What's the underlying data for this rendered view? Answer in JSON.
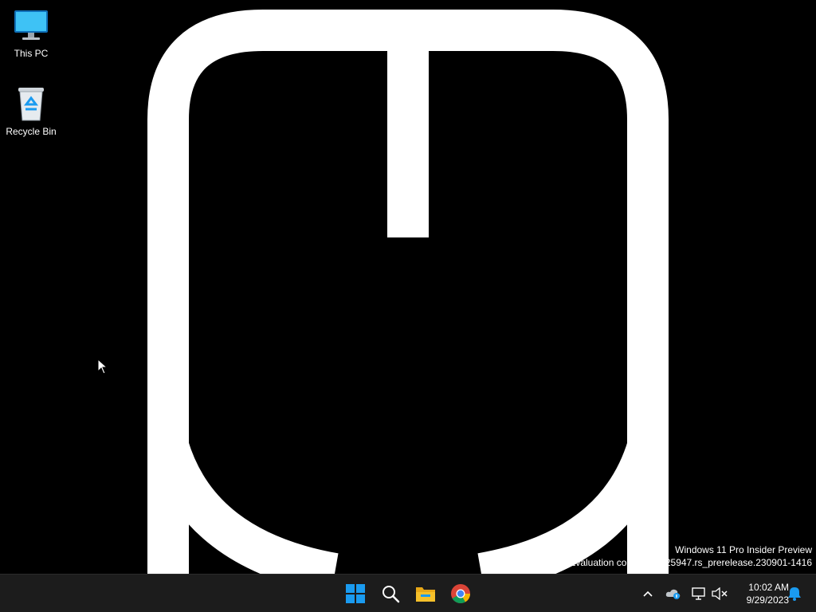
{
  "desktop": {
    "icons": [
      {
        "label": "This PC",
        "icon": "monitor-icon"
      },
      {
        "label": "Recycle Bin",
        "icon": "recycle-bin-icon"
      }
    ],
    "wallpaper": "white mouse outline on black",
    "watermark": {
      "line1": "Windows 11 Pro Insider Preview",
      "line2": "Evaluation copy. Build 25947.rs_prerelease.230901-1416"
    }
  },
  "taskbar": {
    "pinned": [
      {
        "name": "start-button",
        "icon": "windows-logo-icon"
      },
      {
        "name": "search-button",
        "icon": "search-icon"
      },
      {
        "name": "file-explorer",
        "icon": "folder-icon"
      },
      {
        "name": "chrome",
        "icon": "chrome-icon"
      }
    ],
    "tray": {
      "time": "10:02 AM",
      "date": "9/29/2023"
    }
  },
  "colors": {
    "desktop_bg": "#000000",
    "taskbar_bg": "#1c1c1c",
    "windows_blue": "#1a9bf0",
    "folder_yellow": "#f5c02a"
  }
}
